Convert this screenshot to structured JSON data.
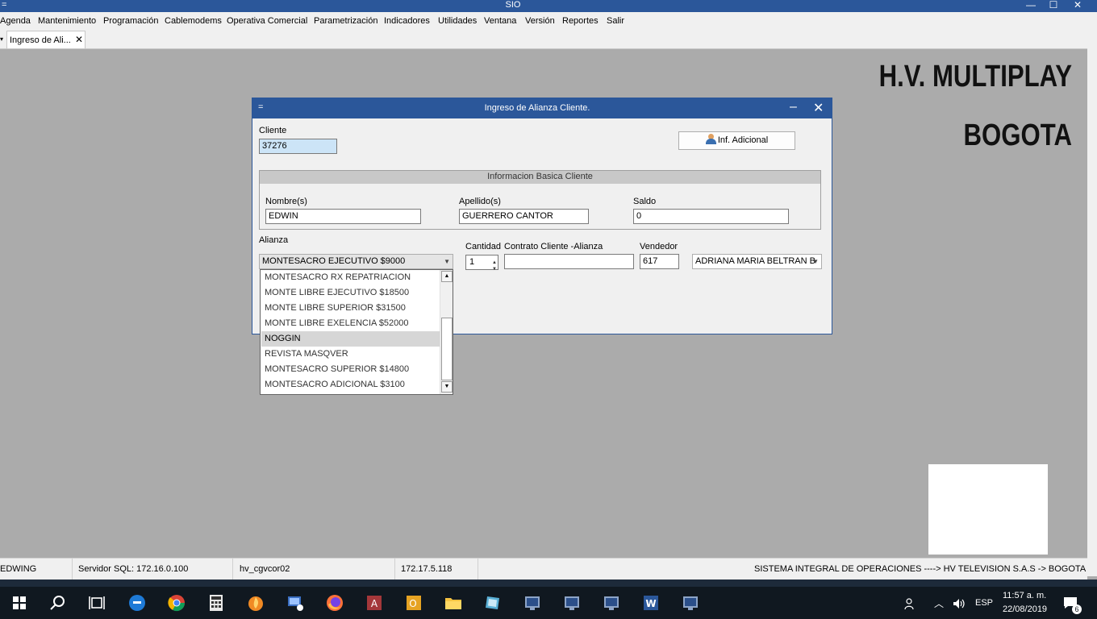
{
  "window": {
    "title": "SIO",
    "system_menu": "=",
    "minimize": "—",
    "maximize": "☐",
    "close": "✕"
  },
  "menu": [
    "Agenda",
    "Mantenimiento",
    "Programación",
    "Cablemodems",
    "Operativa Comercial",
    "Parametrización",
    "Indicadores",
    "Utilidades",
    "Ventana",
    "Versión",
    "Reportes",
    "Salir"
  ],
  "tabs": {
    "arrow": "▾",
    "active_label": "Ingreso de Ali...",
    "close": "✕"
  },
  "workspace": {
    "company_line1": "H.V. MULTIPLAY",
    "company_line2": "BOGOTA"
  },
  "dialog": {
    "system_menu": "=",
    "title": "Ingreso de Alianza Cliente.",
    "minimize": "–",
    "close": "✕",
    "cliente_label": "Cliente",
    "cliente_value": "37276",
    "info_button": "Inf. Adicional",
    "group_title": "Informacion Basica Cliente",
    "nombre_label": "Nombre(s)",
    "nombre_value": "EDWIN",
    "apellido_label": "Apellido(s)",
    "apellido_value": "GUERRERO CANTOR",
    "saldo_label": "Saldo",
    "saldo_value": "0",
    "alianza_label": "Alianza",
    "alianza_value": "MONTESACRO EJECUTIVO $9000",
    "cantidad_label": "Cantidad",
    "cantidad_value": "1",
    "contrato_label": "Contrato Cliente -Alianza",
    "contrato_value": "",
    "vendedor_label": "Vendedor",
    "vendedor_code": "617",
    "vendedor_name": "ADRIANA MARIA BELTRAN B"
  },
  "alianza_options": [
    {
      "label": "MONTESACRO RX REPATRIACION",
      "selected": false
    },
    {
      "label": "MONTE  LIBRE EJECUTIVO $18500",
      "selected": false
    },
    {
      "label": "MONTE  LIBRE SUPERIOR $31500",
      "selected": false
    },
    {
      "label": "MONTE  LIBRE EXELENCIA $52000",
      "selected": false
    },
    {
      "label": "NOGGIN",
      "selected": true
    },
    {
      "label": "REVISTA MASQVER",
      "selected": false
    },
    {
      "label": "MONTESACRO SUPERIOR  $14800",
      "selected": false
    },
    {
      "label": "MONTESACRO ADICIONAL $3100",
      "selected": false
    }
  ],
  "statusbar": {
    "user": "EDWING",
    "server": "Servidor SQL: 172.16.0.100",
    "host": "hv_cgvcor02",
    "ip": "172.17.5.118",
    "system": "SISTEMA INTEGRAL DE OPERACIONES ---->  HV TELEVISION S.A.S -> BOGOTA"
  },
  "taskbar": {
    "language": "ESP",
    "time": "11:57 a. m.",
    "date": "22/08/2019",
    "notifications": "6"
  },
  "colors": {
    "titlebar": "#2b579a",
    "workspace": "#ababab",
    "taskbar": "#101820"
  }
}
